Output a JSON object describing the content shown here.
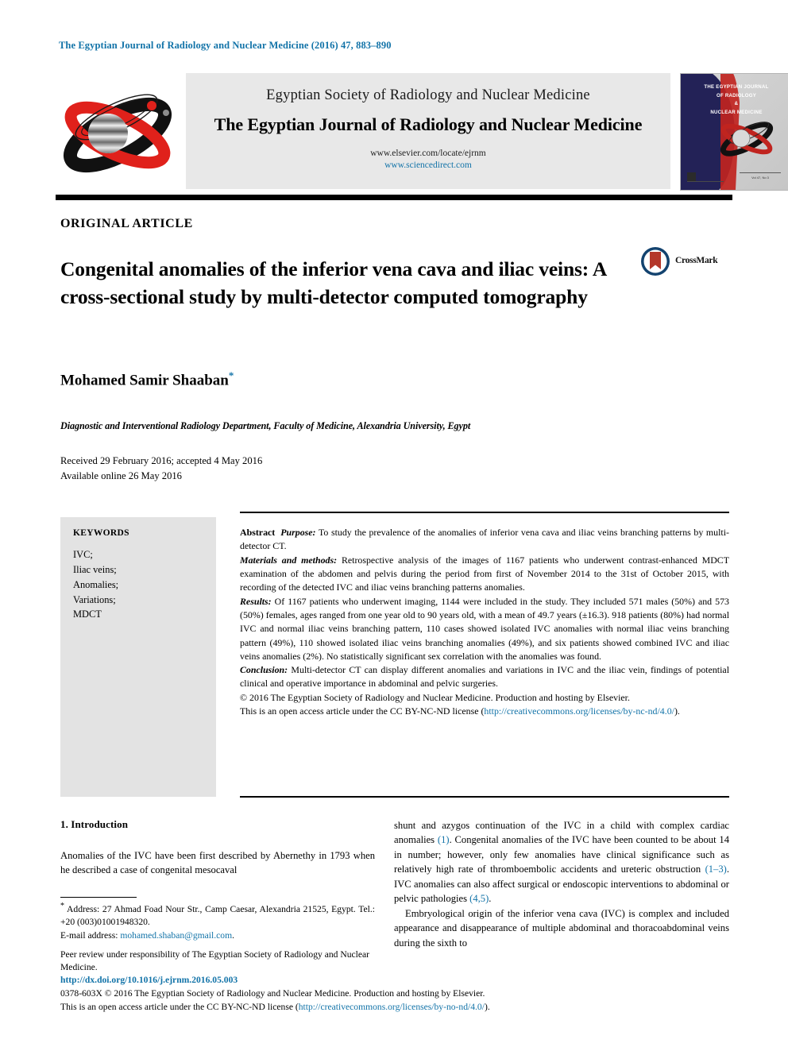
{
  "running_head": "The Egyptian Journal of Radiology and Nuclear Medicine (2016) 47, 883–890",
  "masthead": {
    "society": "Egyptian Society of Radiology and Nuclear Medicine",
    "journal": "The Egyptian Journal of Radiology and Nuclear Medicine",
    "url_elsevier": "www.elsevier.com/locate/ejrnm",
    "url_sciencedirect": "www.sciencedirect.com",
    "cover_title_line1": "THE EGYPTIAN JOURNAL",
    "cover_title_line2": "OF RADIOLOGY",
    "cover_title_line3": "&",
    "cover_title_line4": "NUCLEAR MEDICINE",
    "cover_volume": "Vol 47, No 3"
  },
  "article": {
    "type": "ORIGINAL ARTICLE",
    "title": "Congenital anomalies of the inferior vena cava and iliac veins: A cross-sectional study by multi-detector computed tomography",
    "crossmark_label": "CrossMark",
    "author": "Mohamed Samir Shaaban",
    "author_marker": "*",
    "affiliation": "Diagnostic and Interventional Radiology Department, Faculty of Medicine, Alexandria University, Egypt",
    "received": "Received 29 February 2016; accepted 4 May 2016",
    "available": "Available online 26 May 2016"
  },
  "keywords": {
    "heading": "KEYWORDS",
    "items": [
      "IVC;",
      "Iliac veins;",
      "Anomalies;",
      "Variations;",
      "MDCT"
    ]
  },
  "abstract": {
    "label": "Abstract",
    "purpose_label": "Purpose:",
    "purpose_text": "To study the prevalence of the anomalies of inferior vena cava and iliac veins branching patterns by multi-detector CT.",
    "methods_label": "Materials and methods:",
    "methods_text": "Retrospective analysis of the images of 1167 patients who underwent contrast-enhanced MDCT examination of the abdomen and pelvis during the period from first of November 2014 to the 31st of October 2015, with recording of the detected IVC and iliac veins branching patterns anomalies.",
    "results_label": "Results:",
    "results_text": "Of 1167 patients who underwent imaging, 1144 were included in the study. They included 571 males (50%) and 573 (50%) females, ages ranged from one year old to 90 years old, with a mean of 49.7 years (±16.3). 918 patients (80%) had normal IVC and normal iliac veins branching pattern, 110 cases showed isolated IVC anomalies with normal iliac veins branching pattern (49%), 110 showed isolated iliac veins branching anomalies (49%), and six patients showed combined IVC and iliac veins anomalies (2%). No statistically significant sex correlation with the anomalies was found.",
    "conclusion_label": "Conclusion:",
    "conclusion_text": "Multi-detector CT can display different anomalies and variations in IVC and the iliac vein, findings of potential clinical and operative importance in abdominal and pelvic surgeries.",
    "copyright_line1": "© 2016 The Egyptian Society of Radiology and Nuclear Medicine. Production and hosting by Elsevier.",
    "copyright_line2_a": "This is an open access article under the CC BY-NC-ND license (",
    "copyright_link": "http://creativecommons.org/licenses/by-nc-nd/4.0/",
    "copyright_line2_b": ")."
  },
  "introduction": {
    "heading": "1. Introduction",
    "left_text": "Anomalies of the IVC have been first described by Abernethy in 1793 when he described a case of congenital mesocaval",
    "right_para1_a": "shunt and azygos continuation of the IVC in a child with complex cardiac anomalies ",
    "right_ref1": "(1)",
    "right_para1_b": ". Congenital anomalies of the IVC have been counted to be about 14 in number; however, only few anomalies have clinical significance such as relatively high rate of thromboembolic accidents and ureteric obstruction ",
    "right_ref2": "(1–3)",
    "right_para1_c": ". IVC anomalies can also affect surgical or endoscopic interventions to abdominal or pelvic pathologies ",
    "right_ref3": "(4,5)",
    "right_para1_d": ".",
    "right_para2": "Embryological origin of the inferior vena cava (IVC) is complex and included appearance and disappearance of multiple abdominal and thoracoabdominal veins during the sixth to"
  },
  "footnote": {
    "marker": "*",
    "address": "Address: 27 Ahmad Foad Nour Str., Camp Caesar, Alexandria 21525, Egypt. Tel.: +20 (003)01001948320.",
    "email_label": "E-mail address:",
    "email": "mohamed.shaban@gmail.com",
    "email_period": ".",
    "peer_review": "Peer review under responsibility of The Egyptian Society of Radiology and Nuclear Medicine."
  },
  "page_footer": {
    "doi": "http://dx.doi.org/10.1016/j.ejrnm.2016.05.003",
    "issn_line": "0378-603X © 2016 The Egyptian Society of Radiology and Nuclear Medicine. Production and hosting by Elsevier.",
    "license_a": "This is an open access article under the CC BY-NC-ND license (",
    "license_link": "http://creativecommons.org/licenses/by-no-nd/4.0/",
    "license_b": ")."
  },
  "colors": {
    "link": "#1273a8",
    "cover_navy": "#232257",
    "cover_red": "#c0241f",
    "logo_red": "#e0211b",
    "crossmark_blue": "#13436f",
    "crossmark_red": "#b4372a"
  }
}
